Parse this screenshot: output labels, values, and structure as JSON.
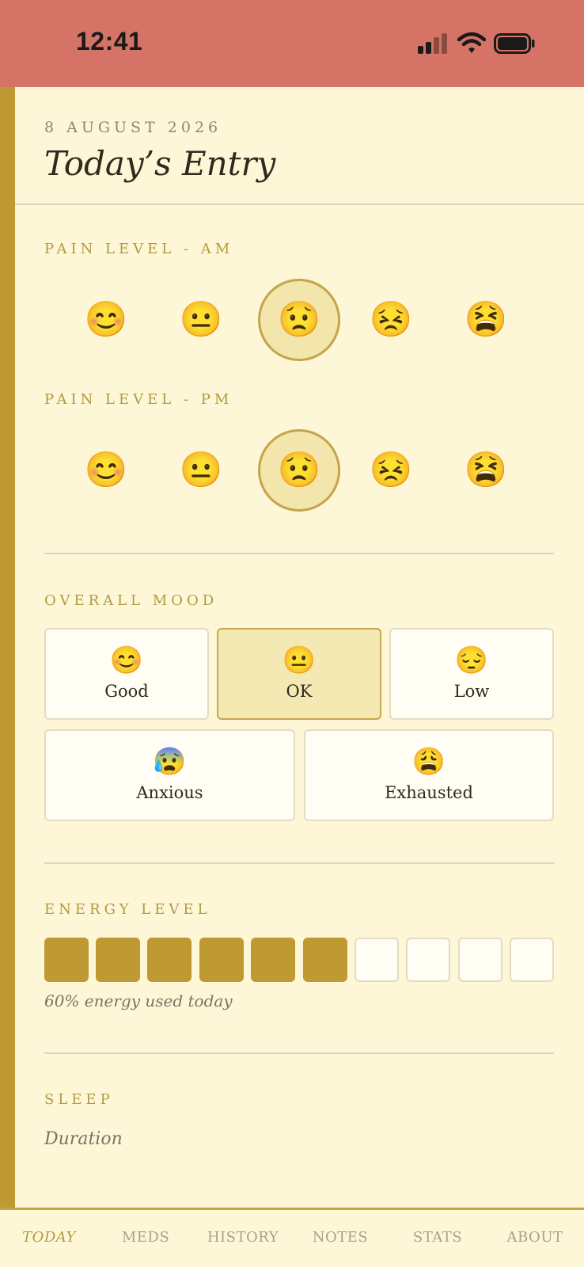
{
  "status_bar": {
    "time": "12:41",
    "icons": [
      "signal-icon",
      "wifi-icon",
      "battery-icon"
    ],
    "background": "#d57466"
  },
  "header": {
    "date": "8 AUGUST 2026",
    "title": "Today’s Entry"
  },
  "pain_am": {
    "label": "PAIN LEVEL - AM",
    "options": [
      "😊",
      "😐",
      "😟",
      "😣",
      "😫"
    ],
    "selected_index": 2
  },
  "pain_pm": {
    "label": "PAIN LEVEL - PM",
    "options": [
      "😊",
      "😐",
      "😟",
      "😣",
      "😫"
    ],
    "selected_index": 2
  },
  "mood": {
    "label": "OVERALL MOOD",
    "options": [
      {
        "emoji": "😊",
        "label": "Good"
      },
      {
        "emoji": "😐",
        "label": "OK"
      },
      {
        "emoji": "😔",
        "label": "Low"
      },
      {
        "emoji": "😰",
        "label": "Anxious"
      },
      {
        "emoji": "😩",
        "label": "Exhausted"
      }
    ],
    "selected": "OK"
  },
  "energy": {
    "label": "ENERGY LEVEL",
    "total_cells": 10,
    "filled_cells": 6,
    "caption": "60% energy used today"
  },
  "sleep": {
    "label": "SLEEP",
    "duration_label": "Duration"
  },
  "tabs": {
    "items": [
      "TODAY",
      "MEDS",
      "HISTORY",
      "NOTES",
      "STATS",
      "ABOUT"
    ],
    "active": "TODAY"
  },
  "colors": {
    "accent": "#bf9a33",
    "background": "#fdf7d8",
    "selected_fill": "#f3e6ad"
  }
}
